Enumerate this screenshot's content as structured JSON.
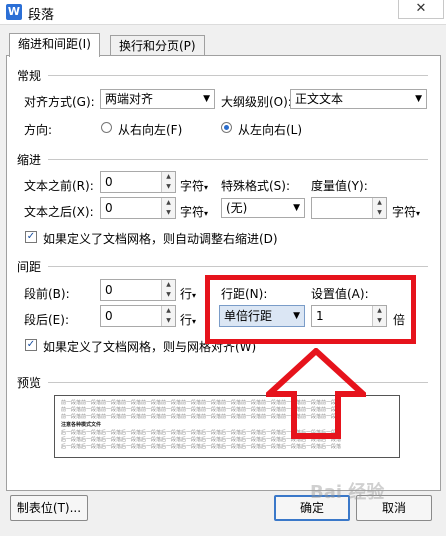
{
  "window": {
    "title": "段落",
    "app_icon_letter": "W",
    "close_glyph": "✕"
  },
  "tabs": [
    {
      "label": "缩进和间距(I)"
    },
    {
      "label": "换行和分页(P)"
    }
  ],
  "general": {
    "heading": "常规",
    "alignment": {
      "label": "对齐方式(G):",
      "value": "两端对齐"
    },
    "outline": {
      "label": "大纲级别(O):",
      "value": "正文文本"
    },
    "direction": {
      "label": "方向:",
      "rtl_label": "从右向左(F)",
      "ltr_label": "从左向右(L)",
      "selected": "ltr"
    }
  },
  "indent": {
    "heading": "缩进",
    "before": {
      "label": "文本之前(R):",
      "value": "0",
      "unit": "字符"
    },
    "after": {
      "label": "文本之后(X):",
      "value": "0",
      "unit": "字符"
    },
    "special": {
      "label": "特殊格式(S):",
      "value": "(无)"
    },
    "measure": {
      "label": "度量值(Y):",
      "value": "",
      "unit": "字符"
    },
    "grid_check": {
      "label": "如果定义了文档网格，则自动调整右缩进(D)",
      "checked": true
    }
  },
  "spacing": {
    "heading": "间距",
    "before": {
      "label": "段前(B):",
      "value": "0",
      "unit": "行"
    },
    "after": {
      "label": "段后(E):",
      "value": "0",
      "unit": "行"
    },
    "line": {
      "label": "行距(N):",
      "value": "单倍行距"
    },
    "setting": {
      "label": "设置值(A):",
      "value": "1",
      "unit": "倍"
    },
    "grid_check": {
      "label": "如果定义了文档网格，则与网格对齐(W)",
      "checked": true
    }
  },
  "preview": {
    "heading": "预览",
    "prev_text": "前一段落前一段落前一段落前一段落前一段落前一段落前一段落前一段落前一段落前一段落前一段落前一段落前一段落前一段落",
    "sample_text": "注意各种模式文件",
    "next_text": "后一段落后一段落后一段落后一段落后一段落后一段落后一段落后一段落后一段落后一段落后一段落后一段落后一段落后一段落"
  },
  "buttons": {
    "tabs": "制表位(T)...",
    "ok": "确定",
    "cancel": "取消"
  },
  "annotation": {
    "color": "#e6131c"
  },
  "watermark": {
    "text": "Bai 经验"
  }
}
